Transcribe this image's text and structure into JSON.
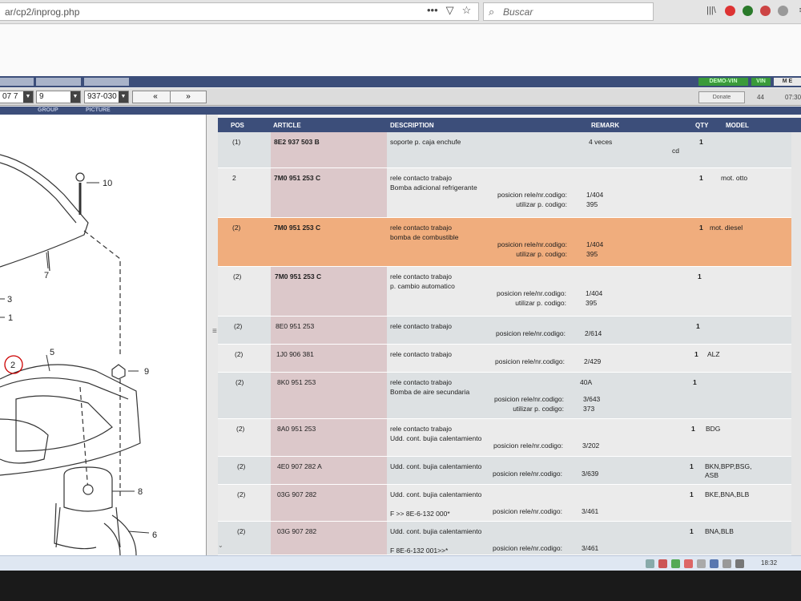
{
  "browser": {
    "url": "ar/cp2/inprog.php",
    "url_menu": "•••",
    "search_placeholder": "Buscar"
  },
  "app": {
    "badges": {
      "demo_vin": "DEMO-VIN",
      "vin": "VIN",
      "menu": "M E"
    },
    "toolbar": {
      "model_value": "07 7",
      "group_value": "9",
      "picture_value": "937-030",
      "prev_label": "«",
      "next_label": "»",
      "donate_label": "Donate",
      "count": "44",
      "time": "07:30"
    },
    "strip_labels": {
      "group": "GROUP",
      "picture": "PICTURE"
    }
  },
  "diagram": {
    "callouts": [
      "10",
      "7",
      "3",
      "1",
      "2",
      "5",
      "9",
      "8",
      "6"
    ]
  },
  "table": {
    "headers": {
      "pos": "POS",
      "article": "ARTICLE",
      "description": "DESCRIPTION",
      "remark": "REMARK",
      "qty": "QTY",
      "model": "MODEL"
    },
    "rows": [
      {
        "pos": "(1)",
        "article": "8E2 937 503 B",
        "desc": [
          "soporte p. caja enchufe"
        ],
        "remark_right": "4 veces",
        "remarks": [],
        "extra": "cd",
        "qty": "1",
        "model": ""
      },
      {
        "pos": "2",
        "article": "7M0 951 253 C",
        "desc": [
          "rele contacto trabajo",
          "Bomba adicional refrigerante"
        ],
        "remark_right": "",
        "remarks": [
          {
            "label": "posicion rele/nr.codigo:",
            "value": "1/404"
          },
          {
            "label": "utilizar p. codigo:",
            "value": "395"
          }
        ],
        "extra": "",
        "qty": "1",
        "model": "mot. otto"
      },
      {
        "pos": "(2)",
        "article": "7M0 951 253 C",
        "desc": [
          "rele contacto trabajo",
          "bomba de combustible"
        ],
        "remark_right": "",
        "remarks": [
          {
            "label": "posicion rele/nr.codigo:",
            "value": "1/404"
          },
          {
            "label": "utilizar p. codigo:",
            "value": "395"
          }
        ],
        "extra": "",
        "qty": "1",
        "model": "mot. diesel"
      },
      {
        "pos": "(2)",
        "article": "7M0 951 253 C",
        "desc": [
          "rele contacto trabajo",
          "p. cambio automatico"
        ],
        "remark_right": "",
        "remarks": [
          {
            "label": "posicion rele/nr.codigo:",
            "value": "1/404"
          },
          {
            "label": "utilizar p. codigo:",
            "value": "395"
          }
        ],
        "extra": "",
        "qty": "1",
        "model": ""
      },
      {
        "pos": "(2)",
        "article": "8E0 951 253",
        "desc": [
          "rele contacto trabajo"
        ],
        "remark_right": "",
        "remarks": [
          {
            "label": "posicion rele/nr.codigo:",
            "value": "2/614"
          }
        ],
        "extra": "",
        "qty": "1",
        "model": ""
      },
      {
        "pos": "(2)",
        "article": "1J0 906 381",
        "desc": [
          "rele contacto trabajo"
        ],
        "remark_right": "",
        "remarks": [
          {
            "label": "posicion rele/nr.codigo:",
            "value": "2/429"
          }
        ],
        "extra": "",
        "qty": "1",
        "model": "ALZ"
      },
      {
        "pos": "(2)",
        "article": "8K0 951 253",
        "desc": [
          "rele contacto trabajo",
          "Bomba de aire secundaria"
        ],
        "remark_right": "40A",
        "remarks": [
          {
            "label": "posicion rele/nr.codigo:",
            "value": "3/643"
          },
          {
            "label": "utilizar p. codigo:",
            "value": "373"
          }
        ],
        "extra": "",
        "qty": "1",
        "model": ""
      },
      {
        "pos": "(2)",
        "article": "8A0 951 253",
        "desc": [
          "rele contacto trabajo",
          "Udd. cont. bujia calentamiento"
        ],
        "remark_right": "",
        "remarks": [
          {
            "label": "posicion rele/nr.codigo:",
            "value": "3/202"
          }
        ],
        "extra": "",
        "qty": "1",
        "model": "BDG"
      },
      {
        "pos": "(2)",
        "article": "4E0 907 282 A",
        "desc": [
          "Udd. cont. bujia calentamiento"
        ],
        "remark_right": "",
        "remarks": [
          {
            "label": "posicion rele/nr.codigo:",
            "value": "3/639"
          }
        ],
        "extra": "",
        "qty": "1",
        "model": "BKN,BPP,BSG, ASB"
      },
      {
        "pos": "(2)",
        "article": "03G 907 282",
        "desc": [
          "Udd. cont. bujia calentamiento",
          "",
          "F          >> 8E-6-132 000*"
        ],
        "remark_right": "",
        "remarks": [
          {
            "label": "posicion rele/nr.codigo:",
            "value": "3/461"
          }
        ],
        "extra": "",
        "qty": "1",
        "model": "BKE,BNA,BLB"
      },
      {
        "pos": "(2)",
        "article": "03G 907 282",
        "desc": [
          "Udd. cont. bujia calentamiento",
          "",
          "F 8E-6-132 001>>*"
        ],
        "remark_right": "",
        "remarks": [
          {
            "label": "posicion rele/nr.codigo:",
            "value": "3/461"
          }
        ],
        "extra": "",
        "qty": "1",
        "model": "BNA,BLB"
      }
    ]
  },
  "taskbar": {
    "clock": "18:32"
  },
  "colors": {
    "header": "#3c4e7a",
    "highlight": "#f0ad7d",
    "article_col": "#dcc8ca",
    "row_odd": "#dde1e3",
    "row_even": "#ebebeb"
  }
}
